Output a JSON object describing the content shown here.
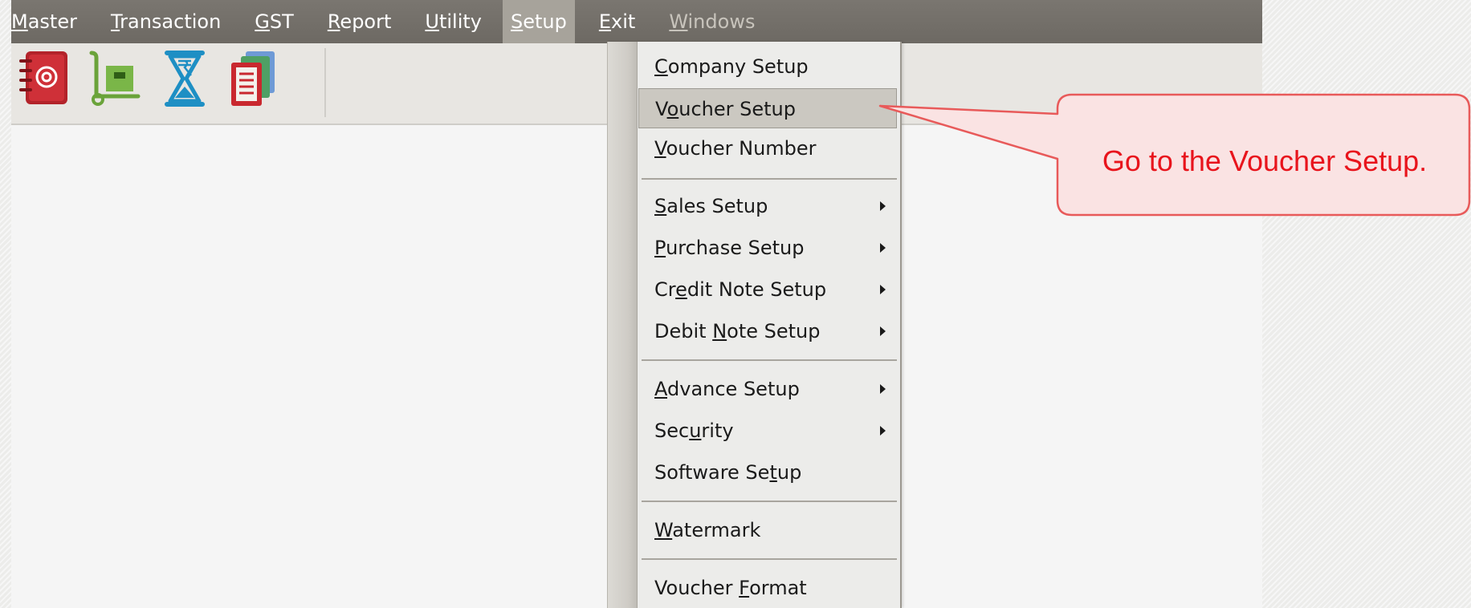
{
  "menubar": {
    "items": [
      {
        "pre": "",
        "u": "M",
        "post": "aster"
      },
      {
        "pre": "",
        "u": "T",
        "post": "ransaction"
      },
      {
        "pre": "",
        "u": "G",
        "post": "ST"
      },
      {
        "pre": "",
        "u": "R",
        "post": "eport"
      },
      {
        "pre": "",
        "u": "U",
        "post": "tility"
      },
      {
        "pre": "",
        "u": "S",
        "post": "etup"
      },
      {
        "pre": "",
        "u": "E",
        "post": "xit"
      },
      {
        "pre": "",
        "u": "W",
        "post": "indows"
      }
    ]
  },
  "toolbar": {
    "icons": [
      "address-book-icon",
      "hand-truck-icon",
      "hourglass-rupee-icon",
      "report-stack-icon"
    ]
  },
  "setup_menu": {
    "items": [
      {
        "pre": "",
        "u": "C",
        "post": "ompany Setup"
      },
      {
        "pre": "V",
        "u": "o",
        "post": "ucher Setup"
      },
      {
        "pre": "",
        "u": "V",
        "post": "oucher Number"
      },
      {
        "pre": "",
        "u": "S",
        "post": "ales Setup"
      },
      {
        "pre": "",
        "u": "P",
        "post": "urchase Setup"
      },
      {
        "pre": "Cr",
        "u": "e",
        "post": "dit Note Setup"
      },
      {
        "pre": "Debit ",
        "u": "N",
        "post": "ote Setup"
      },
      {
        "pre": "",
        "u": "A",
        "post": "dvance Setup"
      },
      {
        "pre": "Sec",
        "u": "u",
        "post": "rity"
      },
      {
        "pre": "Software Se",
        "u": "t",
        "post": "up"
      },
      {
        "pre": "",
        "u": "W",
        "post": "atermark"
      },
      {
        "pre": "Voucher ",
        "u": "F",
        "post": "ormat"
      }
    ]
  },
  "callout": {
    "text": "Go to the Voucher Setup.",
    "fill": "#fae3e3",
    "stroke": "#e85a5a",
    "text_color": "#e8141c"
  }
}
